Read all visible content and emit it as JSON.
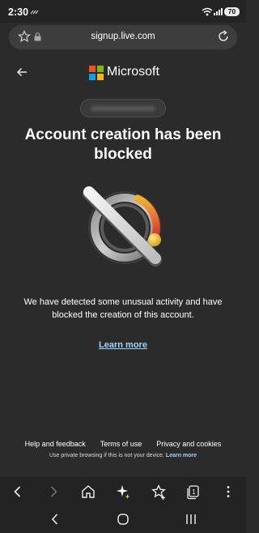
{
  "status_bar": {
    "time": "2:30",
    "battery": "70"
  },
  "address_bar": {
    "url": "signup.live.com"
  },
  "brand": {
    "name": "Microsoft"
  },
  "page": {
    "title": "Account creation has been blocked",
    "message": "We have detected some unusual activity and have blocked the creation of this account.",
    "learn_more": "Learn more"
  },
  "footer": {
    "links": [
      "Help and feedback",
      "Terms of use",
      "Privacy and cookies"
    ],
    "note": "Use private browsing if this is not your device.",
    "note_link": "Learn more"
  },
  "browser_toolbar": {
    "icons": [
      "back-icon",
      "forward-icon",
      "home-icon",
      "ai-sparkle-icon",
      "favorites-icon",
      "tabs-icon",
      "more-icon"
    ],
    "tab_count": "1"
  },
  "system_nav": {
    "icons": [
      "back-icon",
      "home-icon",
      "recents-icon"
    ]
  },
  "colors": {
    "background": "#2b2b2b",
    "link": "#9ed5ff",
    "ms_red": "#f25022",
    "ms_green": "#7fba00",
    "ms_blue": "#00a4ef",
    "ms_yellow": "#ffb900"
  }
}
